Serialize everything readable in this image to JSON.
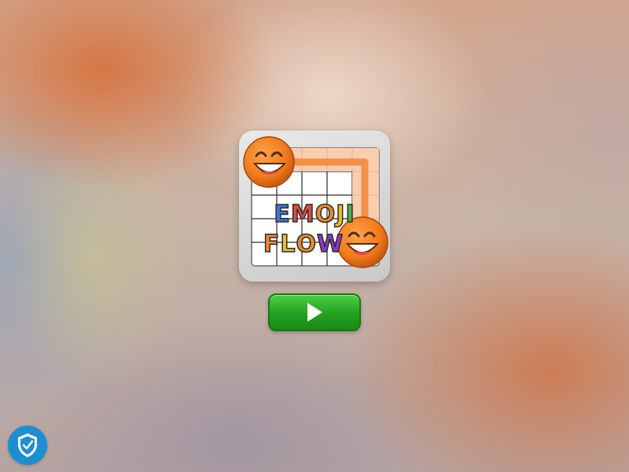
{
  "game": {
    "title_line1": "EMOJI",
    "title_line2": "FLOW",
    "letters_line1": [
      {
        "ch": "E",
        "color": "#3a78d8"
      },
      {
        "ch": "M",
        "color": "#e04a3a"
      },
      {
        "ch": "O",
        "color": "#f08a2a"
      },
      {
        "ch": "J",
        "color": "#e8c12a"
      },
      {
        "ch": "I",
        "color": "#46b44a"
      }
    ],
    "letters_line2": [
      {
        "ch": "F",
        "color": "#f08a2a"
      },
      {
        "ch": "L",
        "color": "#e8c12a"
      },
      {
        "ch": "O",
        "color": "#f08a2a"
      },
      {
        "ch": "W",
        "color": "#8a3ac4"
      }
    ]
  },
  "play_button": {
    "icon": "play-icon",
    "color": "#2fb52b"
  },
  "security_badge": {
    "icon": "shield-check-icon",
    "color": "#1c8fd0"
  },
  "colors": {
    "emoji_orange": "#f07a1a",
    "flow_path": "#f29048"
  }
}
